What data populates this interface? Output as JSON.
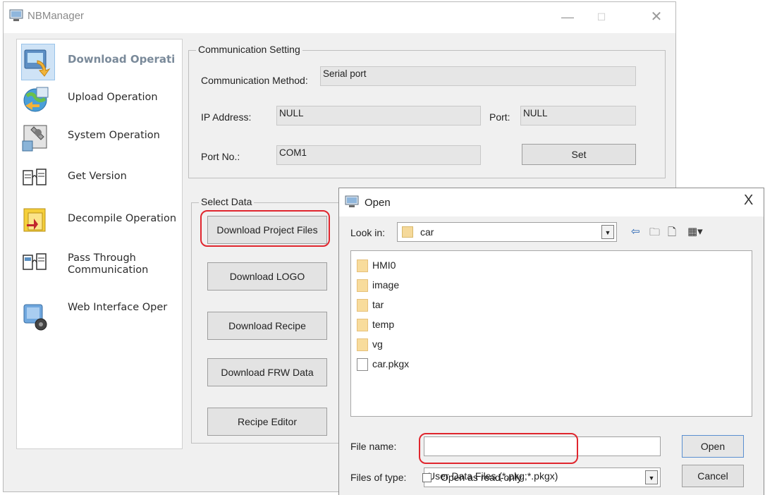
{
  "app": {
    "title": "NBManager",
    "window_controls": {
      "minimize": "—",
      "maximize": "☐",
      "close": "✕"
    }
  },
  "sidebar": {
    "items": [
      {
        "label": "Download Operati",
        "icon": "download-icon",
        "selected": true
      },
      {
        "label": "Upload Operation",
        "icon": "upload-icon",
        "selected": false
      },
      {
        "label": "System Operation",
        "icon": "system-icon",
        "selected": false
      },
      {
        "label": "Get Version",
        "icon": "version-icon",
        "selected": false
      },
      {
        "label": "Decompile Operation",
        "icon": "decompile-icon",
        "selected": false
      },
      {
        "label": "Pass Through\nCommunication",
        "icon": "pass-through-icon",
        "selected": false
      },
      {
        "label": "Web Interface Oper",
        "icon": "web-interface-icon",
        "selected": false
      }
    ]
  },
  "communication": {
    "group_title": "Communication Setting",
    "method_label": "Communication Method:",
    "method_value": "Serial port",
    "ip_label": "IP Address:",
    "ip_value": "NULL",
    "port_label": "Port:",
    "port_value": "NULL",
    "portno_label": "Port No.:",
    "portno_value": "COM1",
    "set_button": "Set"
  },
  "select_data": {
    "group_title": "Select Data",
    "buttons": [
      "Download Project Files",
      "Download LOGO",
      "Download Recipe",
      "Download FRW Data",
      "Recipe Editor"
    ]
  },
  "open_dialog": {
    "title": "Open",
    "close": "X",
    "look_in_label": "Look in:",
    "look_in_value": "car",
    "files": [
      {
        "name": "HMI0",
        "type": "folder"
      },
      {
        "name": "image",
        "type": "folder"
      },
      {
        "name": "tar",
        "type": "folder"
      },
      {
        "name": "temp",
        "type": "folder"
      },
      {
        "name": "vg",
        "type": "folder"
      },
      {
        "name": "car.pkgx",
        "type": "file"
      }
    ],
    "file_name_label": "File name:",
    "file_name_value": "",
    "files_of_type_label": "Files of type:",
    "files_of_type_value": "User Data Files (*.pkg;*.pkgx)",
    "open_button": "Open",
    "cancel_button": "Cancel",
    "readonly_label": "Open as read-only",
    "readonly_checked": false
  },
  "colors": {
    "highlight": "#e0262e",
    "selected_bg": "#cfe3f6",
    "window_bg": "#f0f0f0"
  }
}
